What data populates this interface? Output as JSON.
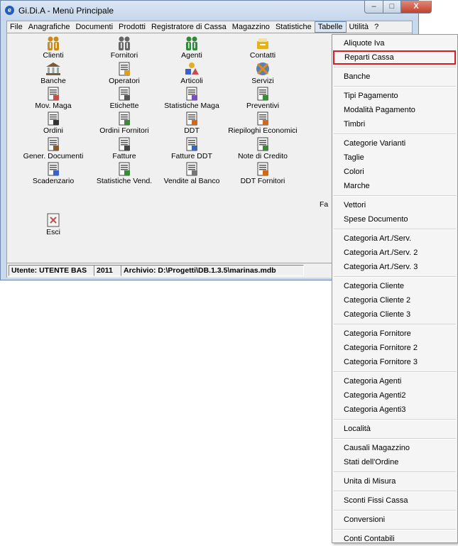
{
  "window": {
    "title": "Gi.Di.A - Menù Principale",
    "icon_glyph": "e",
    "controls": {
      "minimize": "–",
      "maximize": "□",
      "close": "X"
    }
  },
  "menubar": [
    "File",
    "Anagrafiche",
    "Documenti",
    "Prodotti",
    "Registratore di Cassa",
    "Magazzino",
    "Statistiche",
    "Tabelle",
    "Utilità",
    "?"
  ],
  "menubar_active": "Tabelle",
  "grid": [
    {
      "label": "Clienti",
      "icon": "people-icon",
      "color": "#c98a16"
    },
    {
      "label": "Fornitori",
      "icon": "people-icon",
      "color": "#666666"
    },
    {
      "label": "Agenti",
      "icon": "people-icon",
      "color": "#2f8a3a"
    },
    {
      "label": "Contatti",
      "icon": "contacts-icon",
      "color": "#e6b21a"
    },
    {
      "label": "Banche",
      "icon": "bank-icon",
      "color": "#7b5a3a"
    },
    {
      "label": "Operatori",
      "icon": "operator-icon",
      "color": "#d9a01a"
    },
    {
      "label": "Articoli",
      "icon": "shapes-icon",
      "color": "#3a63c9"
    },
    {
      "label": "Servizi",
      "icon": "service-icon",
      "color": "#5a7fb5"
    },
    {
      "label": "Mov. Maga",
      "icon": "warehouse-move-icon",
      "color": "#c0504d"
    },
    {
      "label": "Etichette",
      "icon": "label-printer-icon",
      "color": "#555555"
    },
    {
      "label": "Statistiche Maga",
      "icon": "stats-icon",
      "color": "#7a4fb8"
    },
    {
      "label": "Preventivi",
      "icon": "quote-icon",
      "color": "#3a8a3a"
    },
    {
      "label": "Ordini",
      "icon": "document-icon",
      "color": "#333333"
    },
    {
      "label": "Ordini Fornitori",
      "icon": "supplier-order-icon",
      "color": "#3a8a3a"
    },
    {
      "label": "DDT",
      "icon": "ddt-icon",
      "color": "#d06a1a"
    },
    {
      "label": "Riepiloghi Economici",
      "icon": "summary-icon",
      "color": "#d06a1a"
    },
    {
      "label": "Gener. Documenti",
      "icon": "generate-docs-icon",
      "color": "#8a5a2a"
    },
    {
      "label": "Fatture",
      "icon": "invoice-icon",
      "color": "#444444"
    },
    {
      "label": "Fatture DDT",
      "icon": "invoice-ddt-icon",
      "color": "#3a63c9"
    },
    {
      "label": "Note di Credito",
      "icon": "credit-note-icon",
      "color": "#3a8a3a"
    },
    {
      "label": "Scadenzario",
      "icon": "schedule-icon",
      "color": "#3a63c9"
    },
    {
      "label": "Statistiche Vend.",
      "icon": "sales-stats-icon",
      "color": "#3a8a3a"
    },
    {
      "label": "Vendite al Banco",
      "icon": "counter-sales-icon",
      "color": "#777777"
    },
    {
      "label": "DDT Fornitori",
      "icon": "supplier-ddt-icon",
      "color": "#d06a1a"
    },
    {
      "label": "Esci",
      "icon": "exit-icon",
      "color": "#c0504d"
    }
  ],
  "clipped_label": "Fa",
  "statusbar": {
    "user": "Utente: UTENTE BAS",
    "year": "2011",
    "archive": "Archivio: D:\\Progetti\\DB.1.3.5\\marinas.mdb"
  },
  "dropdown": [
    [
      "Aliquote Iva",
      "Reparti Cassa"
    ],
    [
      "Banche"
    ],
    [
      "Tipi Pagamento",
      "Modalità Pagamento",
      "Timbri"
    ],
    [
      "Categorie Varianti",
      "Taglie",
      "Colori",
      "Marche"
    ],
    [
      "Vettori",
      "Spese Documento"
    ],
    [
      "Categoria Art./Serv.",
      "Categoria Art./Serv. 2",
      "Categoria Art./Serv. 3"
    ],
    [
      "Categoria Cliente",
      "Categoria Cliente 2",
      "Categoria Cliente 3"
    ],
    [
      "Categoria Fornitore",
      "Categoria Fornitore 2",
      "Categoria Fornitore 3"
    ],
    [
      "Categoria Agenti",
      "Categoria Agenti2",
      "Categoria Agenti3"
    ],
    [
      "Località"
    ],
    [
      "Causali Magazzino",
      "Stati dell'Ordine"
    ],
    [
      "Unita di Misura"
    ],
    [
      "Sconti Fissi Cassa"
    ],
    [
      "Conversioni"
    ],
    [
      "Conti Contabili"
    ]
  ],
  "dropdown_selected": "Reparti Cassa",
  "highlight_color": "#d81e1e"
}
